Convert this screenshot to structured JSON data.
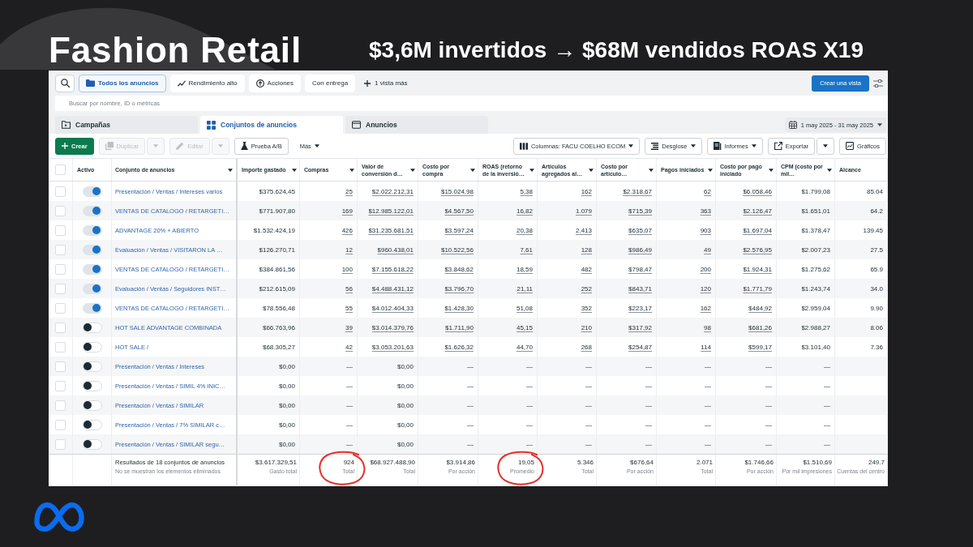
{
  "title": "Fashion Retail",
  "subtitle": "$3,6M invertidos → $68M vendidos ROAS X19",
  "views": {
    "items": [
      {
        "label": "Todos los anuncios",
        "kind": "chip",
        "selected": true
      },
      {
        "label": "Rendimiento alto",
        "kind": "chip",
        "selected": false
      },
      {
        "label": "Acciones",
        "kind": "chip",
        "selected": false
      },
      {
        "label": "Con entrega",
        "kind": "chip",
        "selected": false
      },
      {
        "label": "1 vista más",
        "kind": "more",
        "selected": false
      }
    ],
    "create_button": "Crear una vista"
  },
  "search": {
    "placeholder": "Buscar por nombre, ID o métricas"
  },
  "tabs": [
    {
      "label": "Campañas",
      "selected": false
    },
    {
      "label": "Conjuntos de anuncios",
      "selected": true
    },
    {
      "label": "Anuncios",
      "selected": false
    }
  ],
  "date_range": "1 may 2025 - 31 may 2025",
  "actions": {
    "left": [
      {
        "label": "Crear",
        "kind": "primary",
        "disabled": false
      },
      {
        "label": "Duplicar",
        "kind": "split",
        "disabled": true
      },
      {
        "label": "Editar",
        "kind": "split",
        "disabled": true
      },
      {
        "label": "Prueba A/B",
        "kind": "outline",
        "disabled": false
      },
      {
        "label": "Más",
        "kind": "menu",
        "disabled": false
      }
    ],
    "right": [
      {
        "label": "Columnas: FACU COELHO ECOM",
        "kind": "dropdown",
        "disabled": false
      },
      {
        "label": "Desglose",
        "kind": "dropdown",
        "disabled": false
      },
      {
        "label": "Informes",
        "kind": "dropdown",
        "disabled": false
      },
      {
        "label": "Exportar",
        "kind": "split",
        "disabled": false
      },
      {
        "label": "Gráficos",
        "kind": "outline",
        "disabled": false
      }
    ]
  },
  "table": {
    "header_checked": false,
    "fixed_columns": [
      {
        "label": "Activo",
        "dropdown": false
      },
      {
        "label": "Conjunto de anuncios",
        "dropdown": true
      }
    ],
    "columns": [
      {
        "label": "Importe gastado",
        "dropdown": true,
        "linked": false
      },
      {
        "label": "Compras",
        "dropdown": true,
        "linked": true
      },
      {
        "label": "Valor de conversión d…",
        "dropdown": true,
        "linked": true
      },
      {
        "label": "Costo por compra",
        "dropdown": true,
        "linked": true
      },
      {
        "label": "ROAS (retorno de la inversió…",
        "dropdown": true,
        "linked": true
      },
      {
        "label": "Artículos agregados al…",
        "dropdown": true,
        "linked": true
      },
      {
        "label": "Costo por artículo…",
        "dropdown": true,
        "linked": true
      },
      {
        "label": "Pagos iniciados",
        "dropdown": true,
        "linked": true
      },
      {
        "label": "Costo por pago iniciado",
        "dropdown": true,
        "linked": true
      },
      {
        "label": "CPM (costo por mil…",
        "dropdown": true,
        "linked": false
      },
      {
        "label": "Alcance",
        "dropdown": false,
        "linked": false
      }
    ],
    "rows": [
      {
        "checked": false,
        "on": true,
        "linked": true,
        "name": "Presentación / Ventas / Intereses varios",
        "cells": [
          "$375.624,45",
          "25",
          "$2.022.212,31",
          "$15.024,98",
          "5,38",
          "162",
          "$2.318,67",
          "62",
          "$6.058,46",
          "$1.799,08",
          "85.04"
        ]
      },
      {
        "checked": false,
        "on": true,
        "linked": true,
        "name": "VENTAS DE CATALOGO / RETARGETI…",
        "cells": [
          "$771.907,80",
          "169",
          "$12.985.122,01",
          "$4.567,50",
          "16,82",
          "1.079",
          "$715,39",
          "363",
          "$2.126,47",
          "$1.651,01",
          "64.2"
        ]
      },
      {
        "checked": false,
        "on": true,
        "linked": true,
        "name": "ADVANTAGE 20% + ABIERTO",
        "cells": [
          "$1.532.424,19",
          "426",
          "$31.235.681,51",
          "$3.597,24",
          "20,38",
          "2.413",
          "$635,07",
          "903",
          "$1.697,04",
          "$1.378,47",
          "139.45"
        ]
      },
      {
        "checked": false,
        "on": true,
        "linked": true,
        "name": "Evaluación / Ventas / VISITARON LA …",
        "cells": [
          "$126.270,71",
          "12",
          "$960.438,01",
          "$10.522,56",
          "7,61",
          "128",
          "$986,49",
          "49",
          "$2.576,95",
          "$2.007,23",
          "27.5"
        ]
      },
      {
        "checked": false,
        "on": true,
        "linked": true,
        "name": "VENTAS DE CATALOGO / RETARGETI…",
        "cells": [
          "$384.861,56",
          "100",
          "$7.155.618,22",
          "$3.848,62",
          "18,59",
          "482",
          "$798,47",
          "200",
          "$1.924,31",
          "$1.275,62",
          "65.9"
        ]
      },
      {
        "checked": false,
        "on": true,
        "linked": true,
        "name": "Evaluación / Ventas / Seguidores INST…",
        "cells": [
          "$212.615,09",
          "56",
          "$4.488.431,12",
          "$3.796,70",
          "21,11",
          "252",
          "$843,71",
          "120",
          "$1.771,79",
          "$1.243,74",
          "34.0"
        ]
      },
      {
        "checked": false,
        "on": true,
        "linked": true,
        "name": "VENTAS DE CATALOGO / RETARGETI…",
        "cells": [
          "$78.556,48",
          "55",
          "$4.012.404,33",
          "$1.428,30",
          "51,08",
          "352",
          "$223,17",
          "162",
          "$484,92",
          "$2.959,04",
          "9.90"
        ]
      },
      {
        "checked": false,
        "on": false,
        "linked": true,
        "name": "HOT SALE ADVANTAGE COMBINADA",
        "cells": [
          "$66.763,96",
          "39",
          "$3.014.379,76",
          "$1.711,90",
          "45,15",
          "210",
          "$317,92",
          "98",
          "$681,26",
          "$2.988,27",
          "8.06"
        ]
      },
      {
        "checked": false,
        "on": false,
        "linked": true,
        "name": "HOT SALE /",
        "cells": [
          "$68.305,27",
          "42",
          "$3.053.201,63",
          "$1.626,32",
          "44,70",
          "268",
          "$254,87",
          "114",
          "$599,17",
          "$3.101,40",
          "7.36"
        ]
      },
      {
        "checked": false,
        "on": false,
        "linked": false,
        "name": "Presentación / Ventas / Intereses",
        "cells": [
          "$0,00",
          "—",
          "$0,00",
          "—",
          "—",
          "—",
          "—",
          "—",
          "—",
          "—"
        ]
      },
      {
        "checked": false,
        "on": false,
        "linked": false,
        "name": "Presentación / Ventas / SIMIL 4% INIC…",
        "cells": [
          "$0,00",
          "—",
          "$0,00",
          "—",
          "—",
          "—",
          "—",
          "—",
          "—",
          "—"
        ]
      },
      {
        "checked": false,
        "on": false,
        "linked": false,
        "name": "Presentación / Ventas / SIMILAR",
        "cells": [
          "$0,00",
          "—",
          "$0,00",
          "—",
          "—",
          "—",
          "—",
          "—",
          "—",
          "—"
        ]
      },
      {
        "checked": false,
        "on": false,
        "linked": false,
        "name": "Presentación / Ventas / 7% SIMILAR c…",
        "cells": [
          "$0,00",
          "—",
          "$0,00",
          "—",
          "—",
          "—",
          "—",
          "—",
          "—",
          "—"
        ]
      },
      {
        "checked": false,
        "on": false,
        "linked": false,
        "name": "Presentación / Ventas / SIMILAR segu…",
        "cells": [
          "$0,00",
          "—",
          "$0,00",
          "—",
          "—",
          "—",
          "—",
          "—",
          "—",
          "—"
        ]
      }
    ],
    "footer": {
      "summary": "Resultados de 18 conjuntos de anuncios",
      "note": "No se muestran los elementos eliminados",
      "totals": [
        {
          "value": "$3.617.329,51",
          "label": "Gasto total",
          "circled": false
        },
        {
          "value": "924",
          "label": "Total",
          "circled": true
        },
        {
          "value": "$68.927.488,90",
          "label": "Total",
          "circled": false
        },
        {
          "value": "$3.914,86",
          "label": "Por acción",
          "circled": false
        },
        {
          "value": "19,05",
          "label": "Promedio",
          "circled": true
        },
        {
          "value": "5.346",
          "label": "Total",
          "circled": false
        },
        {
          "value": "$676,64",
          "label": "Por acción",
          "circled": false
        },
        {
          "value": "2.071",
          "label": "Total",
          "circled": false
        },
        {
          "value": "$1.746,66",
          "label": "Por acción",
          "circled": false
        },
        {
          "value": "$1.510,69",
          "label": "Por mil impresiones",
          "circled": false
        },
        {
          "value": "249.7",
          "label": "Cuentas del centro",
          "circled": false
        }
      ]
    }
  }
}
